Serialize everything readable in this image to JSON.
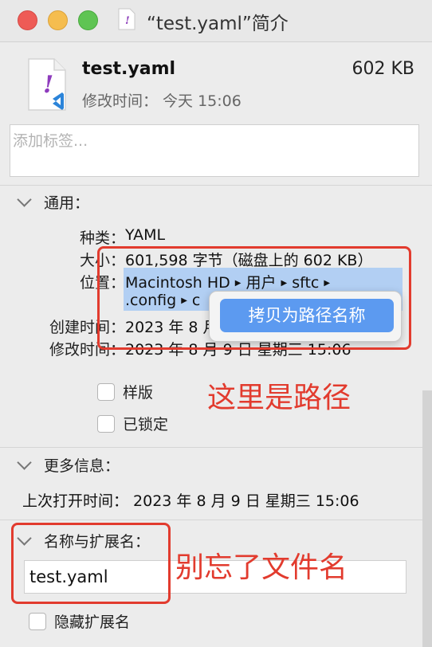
{
  "window": {
    "title": "“test.yaml”简介"
  },
  "file": {
    "name": "test.yaml",
    "size": "602 KB",
    "modified": "修改时间： 今天 15:06"
  },
  "tags": {
    "placeholder": "添加标签..."
  },
  "general": {
    "header": "通用：",
    "kind_label": "种类：",
    "kind_value": "YAML",
    "size_label": "大小：",
    "size_value": "601,598 字节（磁盘上的 602 KB）",
    "where_label": "位置：",
    "path_line1": [
      "Macintosh HD",
      "用户",
      "sftc"
    ],
    "path_line2": [
      ".config",
      "c"
    ],
    "created_label": "创建时间：",
    "created_value": "2023 年 8 月",
    "modified_label": "修改时间：",
    "modified_value": "2023 年 8 月 9 日 星期三 15:06"
  },
  "context_menu": {
    "copy_path": "拷贝为路径名称"
  },
  "checkboxes": {
    "stationery": "样版",
    "locked": "已锁定",
    "hide_extension": "隐藏扩展名"
  },
  "more_info": {
    "header": "更多信息：",
    "last_opened": "上次打开时间： 2023 年 8 月 9 日 星期三 15:06"
  },
  "name_ext": {
    "header": "名称与扩展名：",
    "value": "test.yaml"
  },
  "annotations": {
    "path_note": "这里是路径",
    "filename_note": "别忘了文件名",
    "color": "#e23b2e"
  }
}
